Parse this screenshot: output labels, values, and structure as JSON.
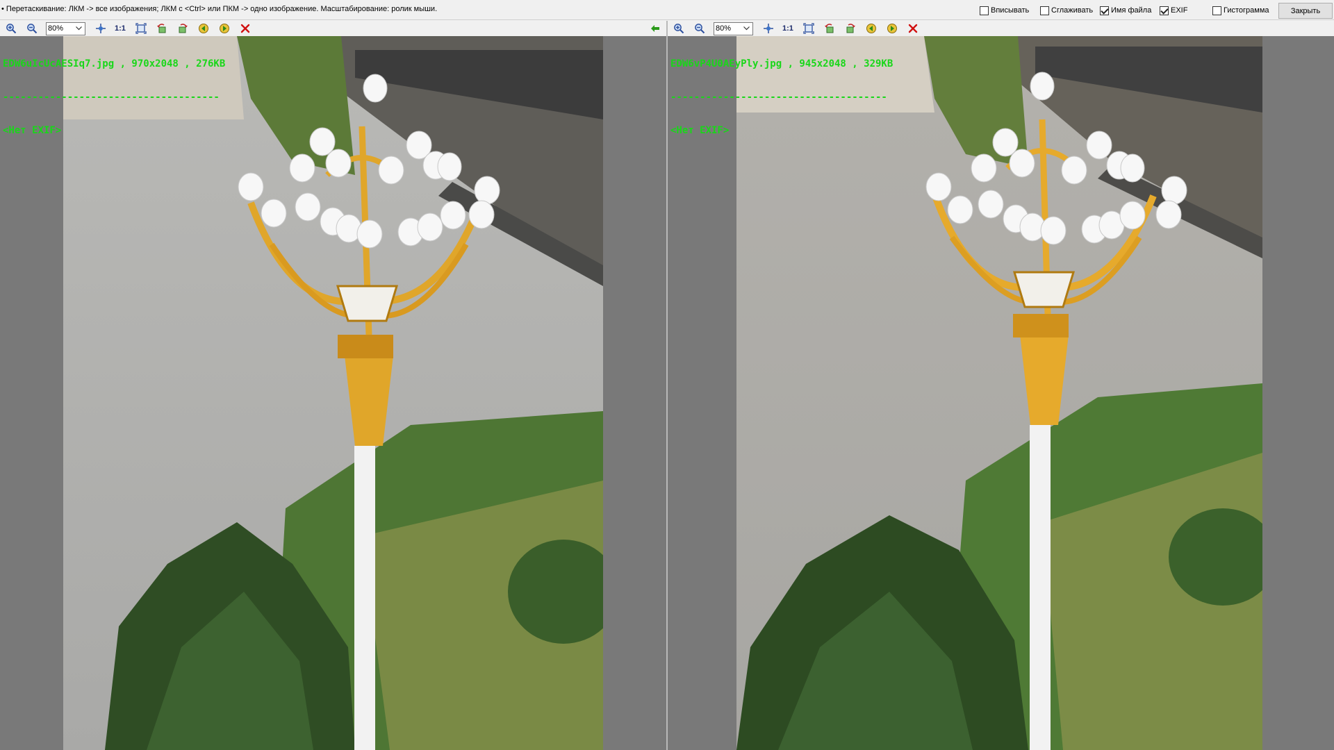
{
  "hint": "• Перетаскивание: ЛКМ -> все изображения; ЛКМ с <Ctrl> или ПКМ -> одно изображение. Масштабирование: ролик мыши.",
  "options": {
    "fit": {
      "label": "Вписывать",
      "checked": false
    },
    "smooth": {
      "label": "Сглаживать",
      "checked": false
    },
    "filename": {
      "label": "Имя файла",
      "checked": true
    },
    "exif": {
      "label": "EXIF",
      "checked": true
    },
    "histogram": {
      "label": "Гистограмма",
      "checked": false
    }
  },
  "close_label": "Закрыть",
  "left": {
    "zoom": "80%",
    "one_to_one": "1:1",
    "file_info": "EDW6uIcUcAESIq7.jpg , 970x2048 , 276KB",
    "separator": "-------------------------------------",
    "exif": "<Нет EXIF>"
  },
  "right": {
    "zoom": "80%",
    "one_to_one": "1:1",
    "file_info": "EDW6vP4U0AEyPly.jpg , 945x2048 , 329KB",
    "separator": "-------------------------------------",
    "exif": "<Нет EXIF>"
  },
  "icons": [
    "zoom-in-icon",
    "zoom-out-icon",
    "fit-icon",
    "actual-size-icon",
    "fullscreen-icon",
    "rotate-left-icon",
    "rotate-right-icon",
    "prev-image-icon",
    "next-image-icon",
    "close-image-icon",
    "sync-arrow-icon"
  ],
  "colors": {
    "overlay_text": "#19d719",
    "viewport_bg": "#797979",
    "close_red": "#d01010",
    "sync_green": "#2a9a1a"
  }
}
